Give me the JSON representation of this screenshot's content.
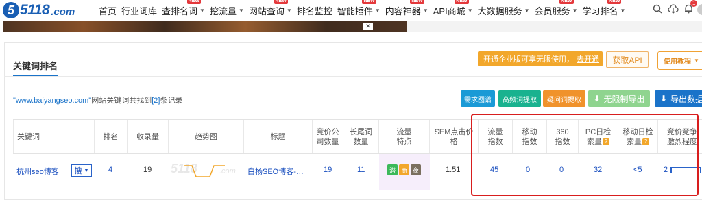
{
  "nav": {
    "logo_mark": "5",
    "logo_text": "5118",
    "logo_suffix": ".com",
    "items": [
      {
        "label": "首页",
        "new": false,
        "caret": false
      },
      {
        "label": "行业词库",
        "new": false,
        "caret": false
      },
      {
        "label": "查排名词",
        "new": true,
        "caret": true
      },
      {
        "label": "挖流量",
        "new": false,
        "caret": true
      },
      {
        "label": "网站查询",
        "new": true,
        "caret": true
      },
      {
        "label": "排名监控",
        "new": false,
        "caret": false
      },
      {
        "label": "智能插件",
        "new": true,
        "caret": true
      },
      {
        "label": "内容神器",
        "new": true,
        "caret": true
      },
      {
        "label": "API商城",
        "new": true,
        "caret": true
      },
      {
        "label": "大数据服务",
        "new": false,
        "caret": true
      },
      {
        "label": "会员服务",
        "new": true,
        "caret": true
      },
      {
        "label": "学习排名",
        "new": true,
        "caret": true
      }
    ],
    "new_badge": "NEW",
    "notification_count": "1"
  },
  "section": {
    "title": "关键词排名"
  },
  "promo": {
    "text": "开通企业版可享无限使用，",
    "link": "去开通"
  },
  "api_button": "获取API",
  "help_button": "使用教程",
  "summary": {
    "site": "\"www.baiyangseo.com\"",
    "text": "网站关键词共找到",
    "count": "[2]",
    "suffix": "条记录"
  },
  "toolbar": [
    {
      "label": "需求图谱",
      "color": "#1a9ad6"
    },
    {
      "label": "高频词提取",
      "color": "#19b28f"
    },
    {
      "label": "疑问词提取",
      "color": "#f0922b"
    },
    {
      "label": "无限制导出",
      "color": "#8fd48f"
    },
    {
      "label": "导出数据",
      "color": "#1a73c9"
    }
  ],
  "table": {
    "headers": [
      "关键词",
      "排名",
      "收录量",
      "趋势图",
      "标题",
      "竞价公司数量",
      "长尾词数量",
      "流量特点",
      "SEM点击价格",
      "流量指数",
      "移动指数",
      "360指数",
      "PC日检索量",
      "移动日检索量",
      "竞价竞争激烈程度"
    ],
    "rows": [
      {
        "keyword": "杭州seo博客",
        "search_select": "搜",
        "rank": "4",
        "indexed": "19",
        "title": "白杨SEO博客-…",
        "bid_companies": "19",
        "longtail": "11",
        "traffic_tags": [
          "潜",
          "商",
          "夜"
        ],
        "sem_price": "1.51",
        "flow_index": "45",
        "mobile_index": "0",
        "index_360": "0",
        "pc_daily": "32",
        "mobile_daily": "<5",
        "competition": "2"
      }
    ]
  },
  "watermark": "5118",
  "watermark_suffix": ".com"
}
